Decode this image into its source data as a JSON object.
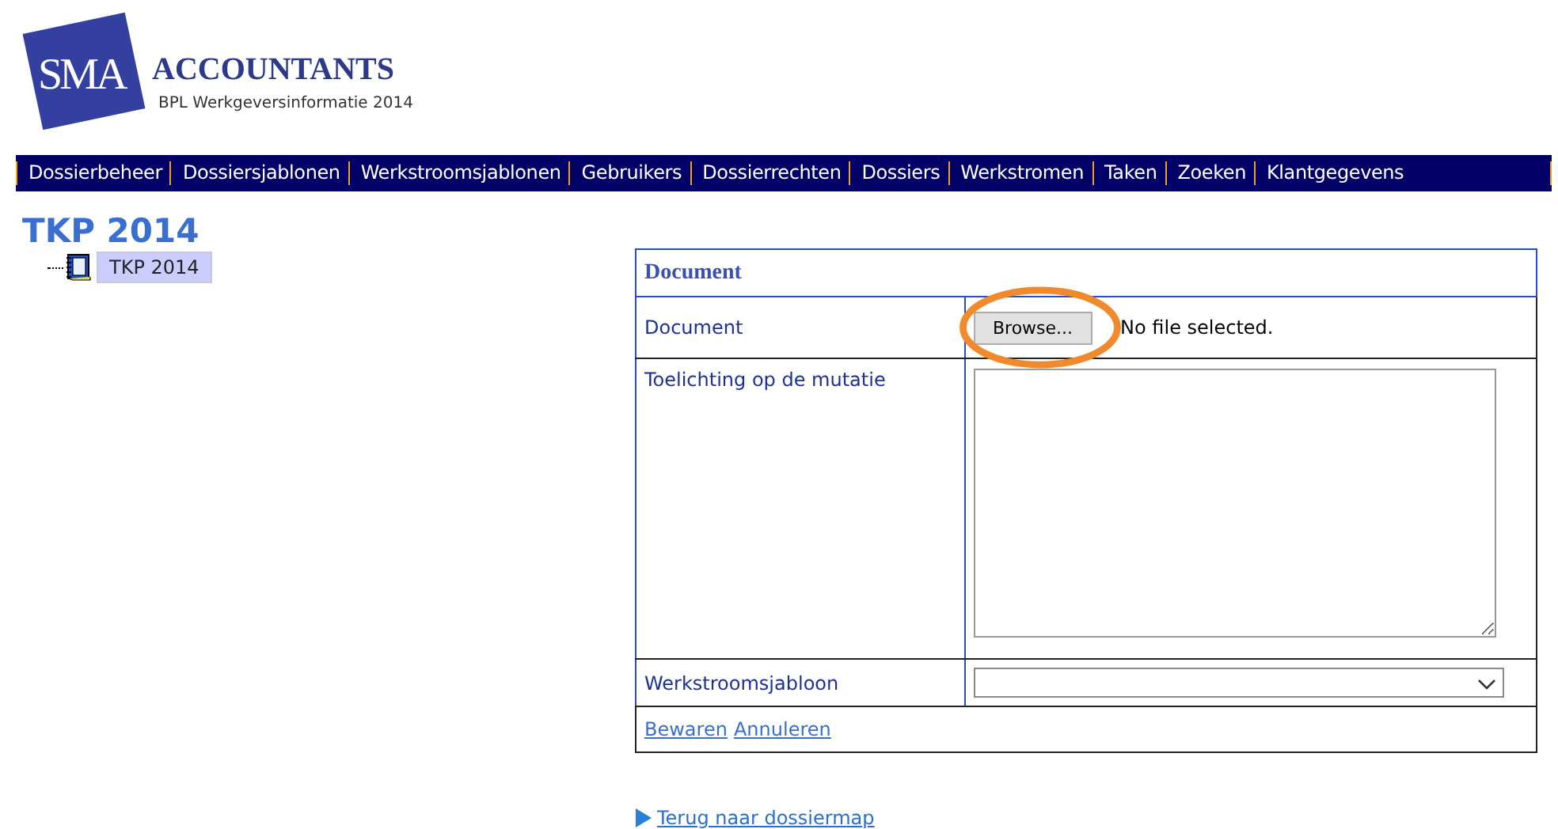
{
  "logo": {
    "mark": "SMA",
    "name": "ACCOUNTANTS",
    "subtitle": "BPL Werkgeversinformatie 2014"
  },
  "nav": [
    "Dossierbeheer",
    "Dossiersjablonen",
    "Werkstroomsjablonen",
    "Gebruikers",
    "Dossierrechten",
    "Dossiers",
    "Werkstromen",
    "Taken",
    "Zoeken",
    "Klantgegevens"
  ],
  "page_title": "TKP 2014",
  "tree": [
    {
      "label": "TKP 2014",
      "selected": true
    }
  ],
  "form": {
    "title": "Document",
    "document": {
      "label": "Document",
      "button": "Browse...",
      "status": "No file selected."
    },
    "note": {
      "label": "Toelichting op de mutatie"
    },
    "workflow": {
      "label": "Werkstroomsjabloon"
    },
    "actions": [
      "Bewaren",
      "Annuleren"
    ]
  },
  "back_link": "Terug naar dossiermap"
}
